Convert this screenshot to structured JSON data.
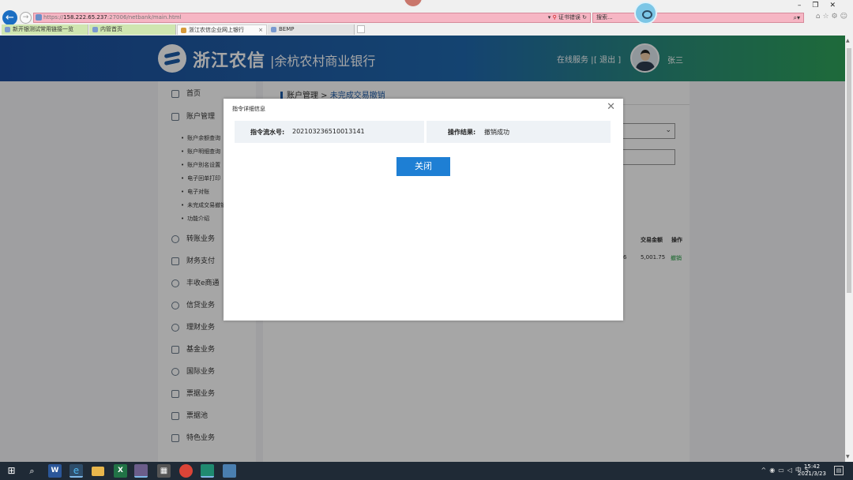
{
  "browser": {
    "url_scheme": "https://",
    "url_host": "158.222.65.237",
    "url_rest": ":27006/netbank/main.html",
    "cert_error": "证书错误",
    "search_placeholder": "搜索...",
    "search_icon": "search-icon",
    "tabs": [
      {
        "label": "新开银测试常用链接一览"
      },
      {
        "label": "内管首页"
      },
      {
        "label": "浙江农信企业网上银行"
      },
      {
        "label": "BEMP"
      }
    ]
  },
  "banner": {
    "brand": "浙江农信",
    "sub_brand": "|余杭农村商业银行",
    "online_service": "在线服务 |",
    "logout": "[ 退出 ]",
    "user_name": "张三"
  },
  "sidebar": {
    "items": [
      {
        "label": "首页"
      },
      {
        "label": "账户管理"
      },
      {
        "label": "转账业务"
      },
      {
        "label": "财务支付"
      },
      {
        "label": "丰收e商通"
      },
      {
        "label": "信贷业务"
      },
      {
        "label": "理财业务"
      },
      {
        "label": "基金业务"
      },
      {
        "label": "国际业务"
      },
      {
        "label": "票据业务"
      },
      {
        "label": "票据池"
      },
      {
        "label": "特色业务"
      }
    ],
    "sub_items": [
      {
        "label": "账户余额查询"
      },
      {
        "label": "账户明细查询"
      },
      {
        "label": "账户别名设置"
      },
      {
        "label": "电子回单打印"
      },
      {
        "label": "电子对账"
      },
      {
        "label": "未完成交易撤销"
      },
      {
        "label": "功能介绍"
      }
    ]
  },
  "content": {
    "crumb_root": "账户管理",
    "crumb_sep": " > ",
    "crumb_current": "未完成交易撤销",
    "th_amount": "交易金额",
    "th_op": "操作",
    "row_prev_fragment": "6",
    "row_amount": "5,001.75",
    "row_op": "撤销"
  },
  "modal": {
    "title": "指令详细信息",
    "serial_label": "指令流水号:",
    "serial_value": "202103236510013141",
    "result_label": "操作结果:",
    "result_value": "撤销成功",
    "close_button": "关闭"
  },
  "taskbar": {
    "time": "15:42",
    "date": "2021/3/23"
  }
}
